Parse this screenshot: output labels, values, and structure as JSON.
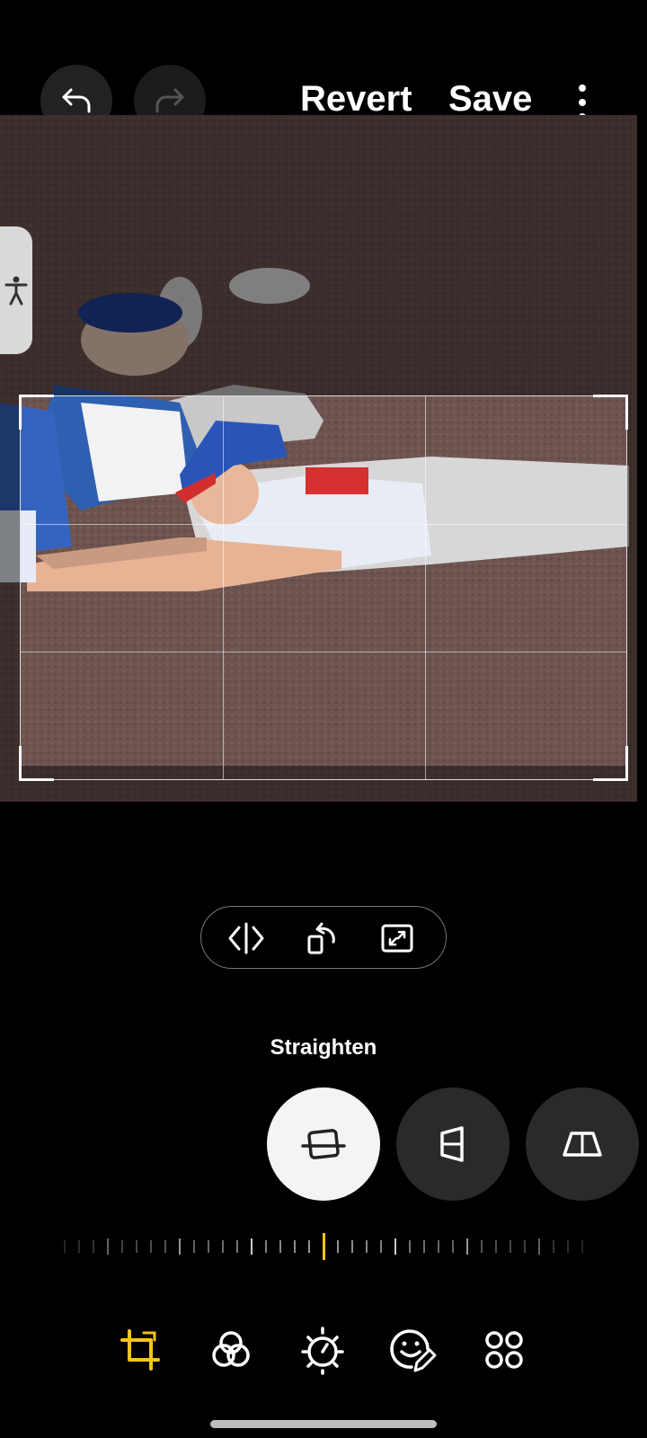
{
  "header": {
    "undo_icon": "undo-arrow-icon",
    "redo_icon": "redo-arrow-icon",
    "revert_label": "Revert",
    "save_label": "Save",
    "more_icon": "more-vertical-icon"
  },
  "editor": {
    "accessibility_icon": "accessibility-person-icon",
    "transform_tools": [
      "flip-icon",
      "rotate-icon",
      "expand-icon"
    ],
    "adjust_label": "Straighten",
    "modes": [
      "straighten-icon",
      "vertical-perspective-icon",
      "horizontal-perspective-icon"
    ],
    "active_mode": "straighten-icon",
    "straighten_value": 0
  },
  "bottom_nav": {
    "items": [
      "crop-transform-icon",
      "filters-icon",
      "brightness-icon",
      "sticker-draw-icon",
      "more-tools-icon"
    ],
    "active": "crop-transform-icon",
    "accent": "#f5c518"
  }
}
